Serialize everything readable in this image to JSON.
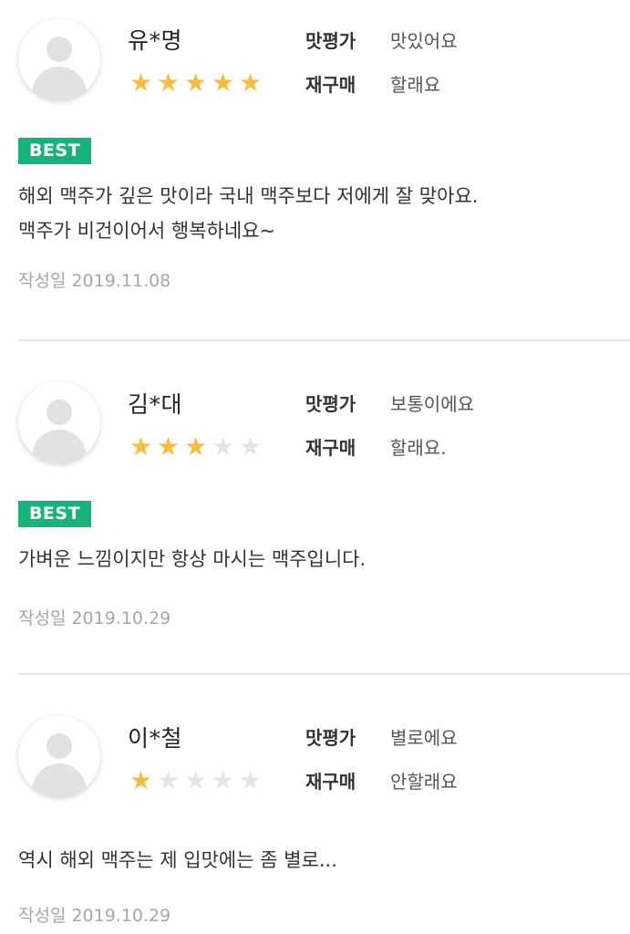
{
  "labels": {
    "taste": "맛평가",
    "repurchase": "재구매",
    "date_prefix": "작성일",
    "best_badge": "BEST"
  },
  "colors": {
    "star_on": "#f7bd3f",
    "star_off": "#e5e5e5",
    "best_badge": "#16b47a"
  },
  "reviews": [
    {
      "name": "유*명",
      "rating": 5,
      "max_rating": 5,
      "taste": "맛있어요",
      "repurchase": "할래요",
      "best": true,
      "content": "해외 맥주가 깊은 맛이라 국내 맥주보다 저에게 잘 맞아요.\n맥주가 비건이어서 행복하네요~",
      "date": "2019.11.08"
    },
    {
      "name": "김*대",
      "rating": 3,
      "max_rating": 5,
      "taste": "보통이에요",
      "repurchase": "할래요.",
      "best": true,
      "content": "가벼운 느낌이지만 항상 마시는 맥주입니다.",
      "date": "2019.10.29"
    },
    {
      "name": "이*철",
      "rating": 1,
      "max_rating": 5,
      "taste": "별로에요",
      "repurchase": "안할래요",
      "best": false,
      "content": "역시 해외 맥주는 제 입맛에는 좀 별로...",
      "date": "2019.10.29"
    }
  ]
}
